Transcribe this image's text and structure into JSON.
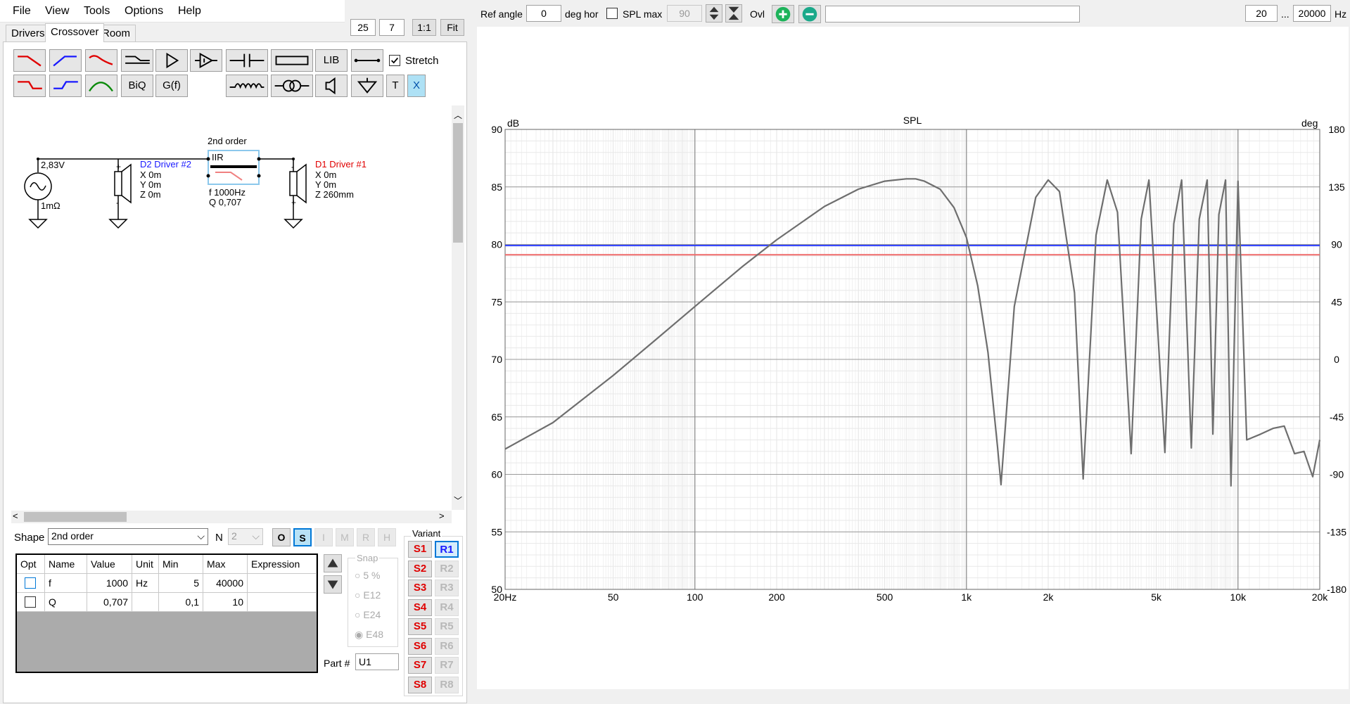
{
  "menu": [
    "File",
    "View",
    "Tools",
    "Options",
    "Help"
  ],
  "tabs": [
    "Drivers",
    "Crossover",
    "Room"
  ],
  "top_left_controls": {
    "val_a": "25",
    "val_b": "7",
    "one_to_one": "1:1",
    "fit": "Fit"
  },
  "toolbar": {
    "lib": "LIB",
    "stretch": "Stretch",
    "stretch_checked": true,
    "biq": "BiQ",
    "gf": "G(f)",
    "t": "T",
    "x": "X"
  },
  "schematic": {
    "source_voltage": "2,83V",
    "source_impedance": "1mΩ",
    "filter_title": "2nd order",
    "filter_type": "IIR",
    "filter_f": "f   1000Hz",
    "filter_q": "Q  0,707",
    "driver2": {
      "name": "D2 Driver #2",
      "x": "X 0m",
      "y": "Y 0m",
      "z": "Z 0m",
      "color": "#1a1aff"
    },
    "driver1": {
      "name": "D1 Driver #1",
      "x": "X 0m",
      "y": "Y 0m",
      "z": "Z 260mm",
      "color": "#e00000"
    }
  },
  "shape_row": {
    "shape_label": "Shape",
    "shape_value": "2nd order",
    "n_label": "N",
    "n_value": "2",
    "buttons": [
      "O",
      "S",
      "I",
      "M",
      "R",
      "H"
    ]
  },
  "table": {
    "headers": [
      "Opt",
      "Name",
      "Value",
      "Unit",
      "Min",
      "Max",
      "Expression"
    ],
    "rows": [
      {
        "name": "f",
        "value": "1000",
        "unit": "Hz",
        "min": "5",
        "max": "40000",
        "expr": ""
      },
      {
        "name": "Q",
        "value": "0,707",
        "unit": "",
        "min": "0,1",
        "max": "10",
        "expr": ""
      }
    ]
  },
  "snap": {
    "label": "Snap",
    "options": [
      "5 %",
      "E12",
      "E24",
      "E48"
    ],
    "selected": "E48"
  },
  "part": {
    "label": "Part #",
    "value": "U1"
  },
  "variant": {
    "label": "Variant",
    "s": [
      "S1",
      "S2",
      "S3",
      "S4",
      "S5",
      "S6",
      "S7",
      "S8"
    ],
    "r": [
      "R1",
      "R2",
      "R3",
      "R4",
      "R5",
      "R6",
      "R7",
      "R8"
    ]
  },
  "top_right": {
    "ref_angle_label": "Ref angle",
    "ref_angle_value": "0",
    "deg_hor": "deg hor",
    "spl_max_label": "SPL max",
    "spl_max_value": "90",
    "ovl": "Ovl",
    "freq_from": "20",
    "ellipsis": "...",
    "freq_to": "20000",
    "hz": "Hz"
  },
  "chart_data": {
    "type": "line",
    "title": "SPL",
    "ylabel_left": "dB",
    "ylabel_right": "deg",
    "xscale": "log",
    "xlim": [
      20,
      20000
    ],
    "ylim": [
      50,
      90
    ],
    "y2lim": [
      -180,
      180
    ],
    "x_tick_labels": [
      "20Hz",
      "50",
      "100",
      "200",
      "500",
      "1k",
      "2k",
      "5k",
      "10k",
      "20k"
    ],
    "y_tick_labels": [
      "90",
      "85",
      "80",
      "75",
      "70",
      "65",
      "60",
      "55",
      "50"
    ],
    "y2_tick_labels": [
      "180",
      "135",
      "90",
      "45",
      "0",
      "-45",
      "-90",
      "-135",
      "-180"
    ],
    "grid": true,
    "colors": {
      "spl": "#6e6e6e",
      "blue": "#2a3cff",
      "red": "#f06a6a"
    },
    "series": [
      {
        "values_note": "comb",
        "x": [
          20,
          30,
          50,
          70,
          100,
          150,
          200,
          300,
          400,
          500,
          600,
          650,
          700,
          800,
          900,
          1000,
          1100,
          1200,
          1300,
          1340,
          1500,
          1800,
          2000,
          2200,
          2500,
          2690,
          3000,
          3300,
          3600,
          4040,
          4400,
          4700,
          5380,
          5800,
          6200,
          6730,
          7200,
          7700,
          8080,
          8500,
          9000,
          9420,
          10000,
          10770,
          12110,
          13460,
          14800,
          16150,
          17500,
          18840,
          20000
        ],
        "values": [
          62.2,
          64.5,
          68.6,
          71.5,
          74.6,
          78.1,
          80.4,
          83.3,
          84.8,
          85.5,
          85.7,
          85.7,
          85.5,
          84.8,
          83.2,
          80.6,
          76.4,
          70.6,
          62.5,
          59.1,
          74.6,
          84.1,
          85.6,
          84.6,
          75.8,
          59.6,
          80.8,
          85.6,
          82.8,
          61.8,
          82.2,
          85.6,
          61.9,
          81.8,
          85.6,
          62.3,
          82.2,
          85.6,
          63.5,
          82.6,
          85.6,
          59.0,
          85.5,
          63.0,
          63.5,
          64.0,
          64.2,
          61.8,
          62.0,
          59.8,
          63.0
        ]
      }
    ],
    "horizontal_lines": [
      {
        "color": "blue",
        "y": 79.9
      },
      {
        "color": "red",
        "y": 79.1
      }
    ]
  }
}
